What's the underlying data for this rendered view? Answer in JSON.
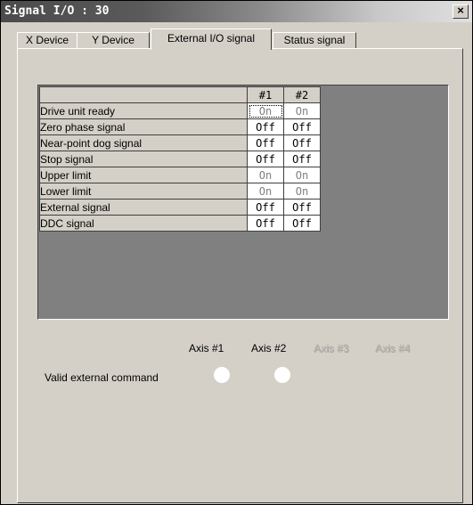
{
  "window": {
    "title": "Signal I/O : 30",
    "close_label": "×"
  },
  "tabs": [
    {
      "label": "X Device",
      "active": false
    },
    {
      "label": "Y Device",
      "active": false
    },
    {
      "label": "External I/O signal",
      "active": true
    },
    {
      "label": "Status signal",
      "active": false
    }
  ],
  "table": {
    "columns": [
      "",
      "#1",
      "#2"
    ],
    "rows": [
      {
        "name": "Drive unit ready",
        "v1": "On",
        "v2": "On"
      },
      {
        "name": "Zero phase signal",
        "v1": "Off",
        "v2": "Off"
      },
      {
        "name": "Near-point dog signal",
        "v1": "Off",
        "v2": "Off"
      },
      {
        "name": "Stop signal",
        "v1": "Off",
        "v2": "Off"
      },
      {
        "name": "Upper limit",
        "v1": "On",
        "v2": "On"
      },
      {
        "name": "Lower limit",
        "v1": "On",
        "v2": "On"
      },
      {
        "name": "External signal",
        "v1": "Off",
        "v2": "Off"
      },
      {
        "name": "DDC signal",
        "v1": "Off",
        "v2": "Off"
      }
    ]
  },
  "axes": {
    "labels": [
      "Axis #1",
      "Axis #2",
      "Axis #3",
      "Axis #4"
    ],
    "enabled": [
      true,
      true,
      false,
      false
    ]
  },
  "valid_external_command": {
    "label": "Valid external command",
    "lamps": [
      "off",
      "off"
    ]
  },
  "colors": {
    "on_text": "#808080",
    "off_text": "#000000",
    "panel": "#d4d0c8",
    "grid_bg": "#808080"
  }
}
